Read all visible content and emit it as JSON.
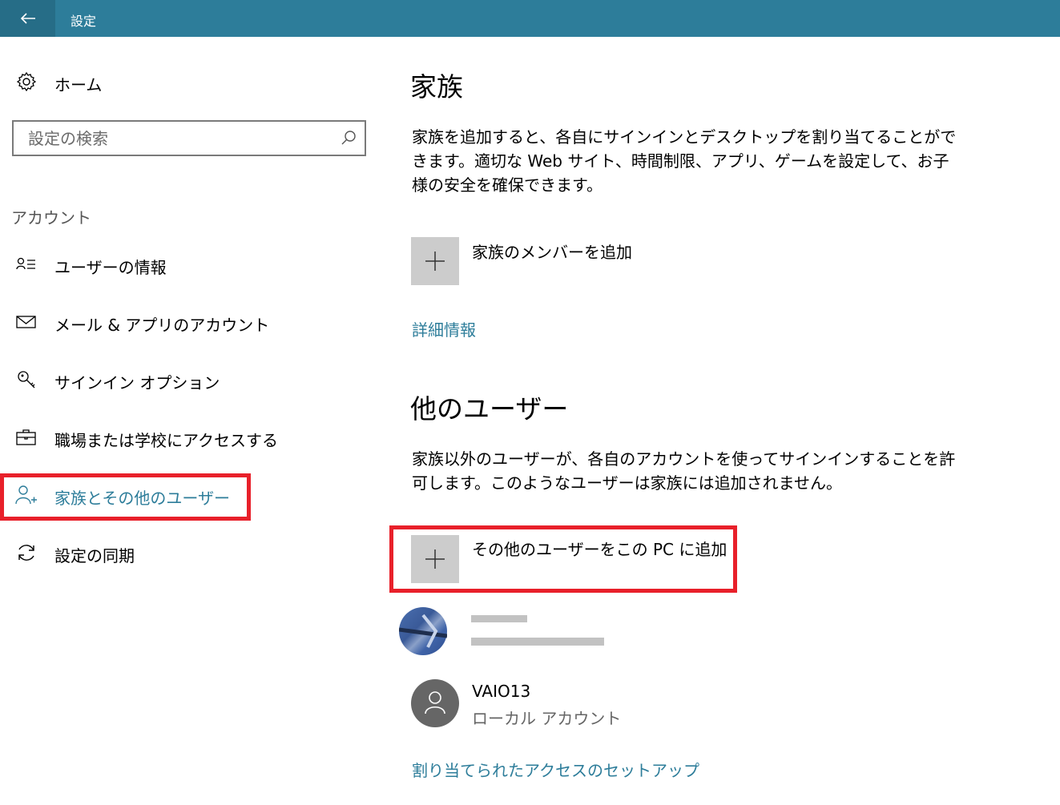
{
  "window": {
    "title": "設定"
  },
  "sidebar": {
    "home_label": "ホーム",
    "search_placeholder": "設定の検索",
    "section_label": "アカウント",
    "items": [
      {
        "label": "ユーザーの情報",
        "icon": "user-info-icon"
      },
      {
        "label": "メール & アプリのアカウント",
        "icon": "mail-icon"
      },
      {
        "label": "サインイン オプション",
        "icon": "key-icon"
      },
      {
        "label": "職場または学校にアクセスする",
        "icon": "briefcase-icon"
      },
      {
        "label": "家族とその他のユーザー",
        "icon": "add-person-icon",
        "selected": true
      },
      {
        "label": "設定の同期",
        "icon": "sync-icon"
      }
    ]
  },
  "main": {
    "family": {
      "heading": "家族",
      "description": "家族を追加すると、各自にサインインとデスクトップを割り当てることができます。適切な Web サイト、時間制限、アプリ、ゲームを設定して、お子様の安全を確保できます。",
      "add_label": "家族のメンバーを追加",
      "link": "詳細情報"
    },
    "other_users": {
      "heading": "他のユーザー",
      "description": "家族以外のユーザーが、各自のアカウントを使ってサインインすることを許可します。このようなユーザーは家族には追加されません。",
      "add_label": "その他のユーザーをこの PC に追加",
      "users": [
        {
          "name": "",
          "sub": "",
          "icon": "user-photo-avatar"
        },
        {
          "name": "VAIO13",
          "sub": "ローカル アカウント",
          "icon": "person-avatar-icon"
        }
      ],
      "link": "割り当てられたアクセスのセットアップ"
    }
  },
  "colors": {
    "titlebar": "#2d7d9a",
    "accent": "#2d7d9a",
    "highlight": "#e8202a",
    "tile": "#cccccc"
  }
}
